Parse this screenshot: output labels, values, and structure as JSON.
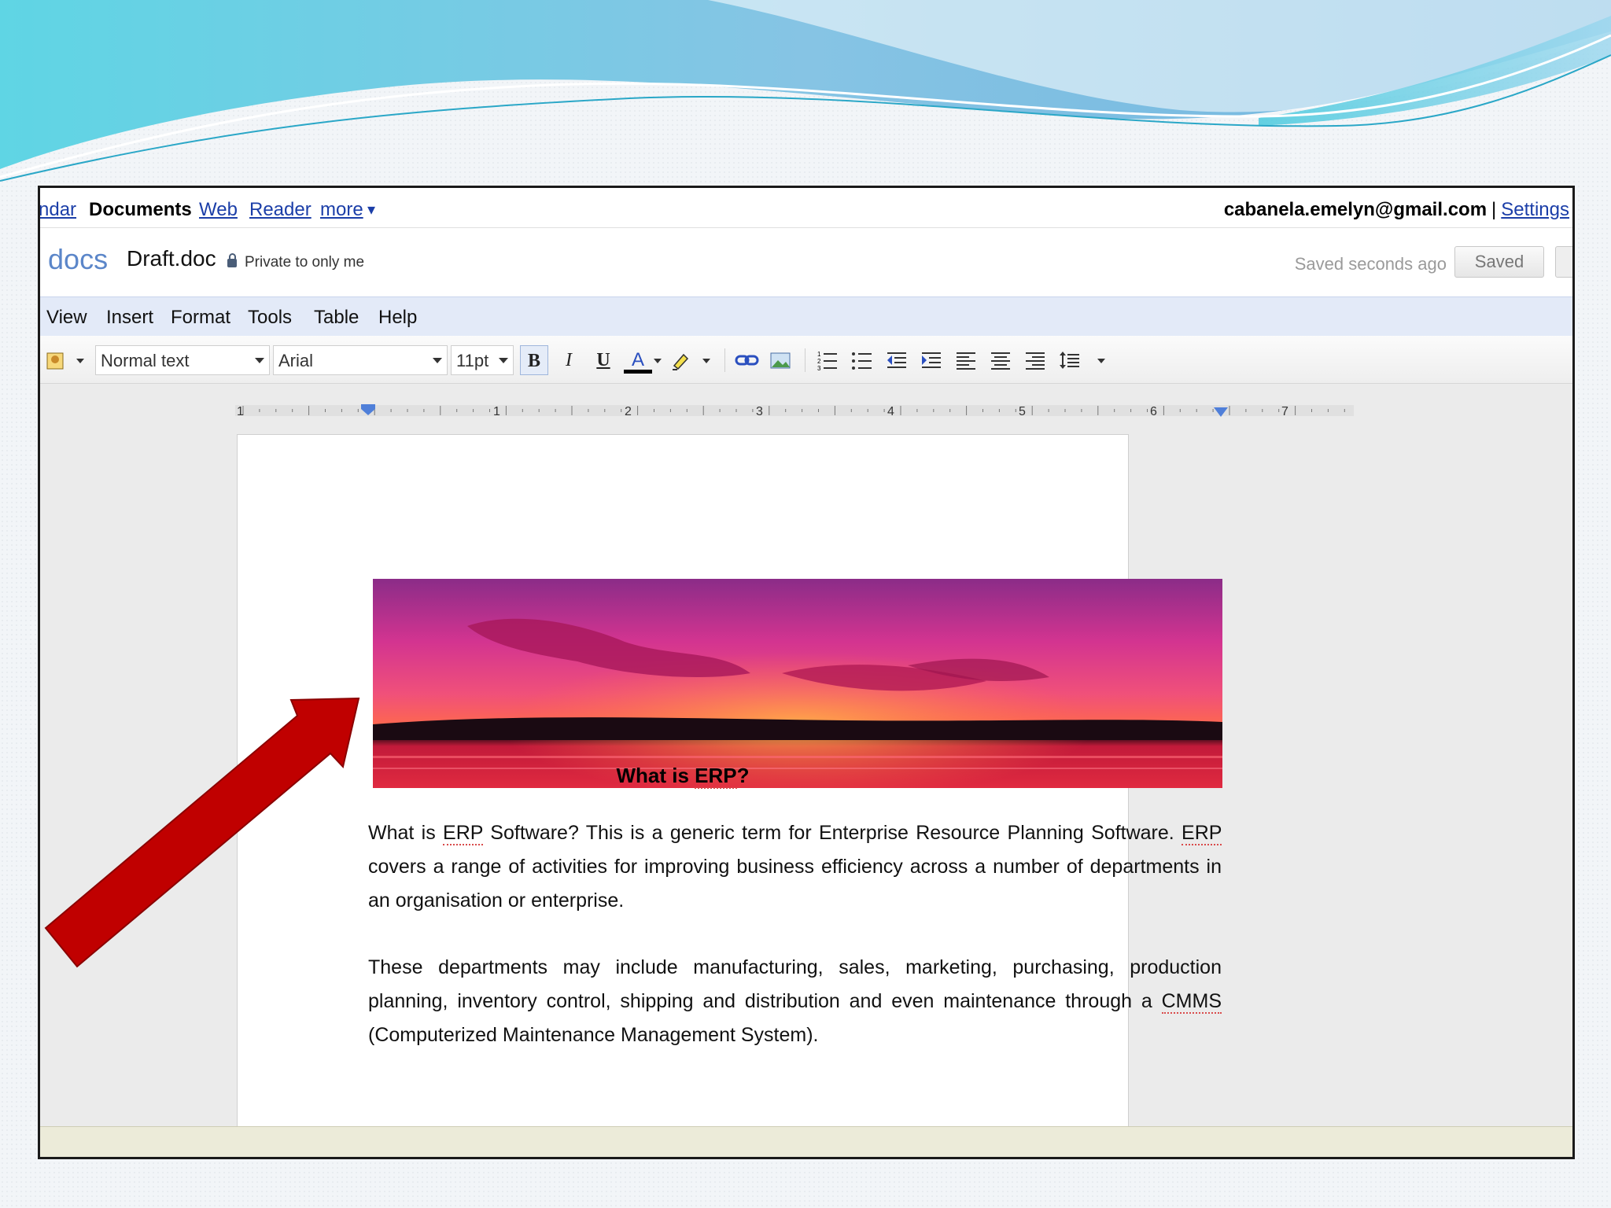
{
  "topnav": {
    "items": [
      {
        "label": "ndar",
        "style": "link"
      },
      {
        "label": "Documents",
        "style": "bold"
      },
      {
        "label": "Web",
        "style": "link"
      },
      {
        "label": "Reader",
        "style": "link"
      },
      {
        "label": "more",
        "style": "link"
      }
    ],
    "more_caret": "▾",
    "account_email": "cabanela.emelyn@gmail.com",
    "separator": "|",
    "settings_label": "Settings"
  },
  "docbar": {
    "logo": "docs",
    "logo_prefix": ":",
    "doc_title": "Draft.doc",
    "sharing": "Private to only me",
    "save_status": "Saved seconds ago",
    "saved_button": "Saved"
  },
  "menubar": {
    "items": [
      "View",
      "Insert",
      "Format",
      "Tools",
      "Table",
      "Help"
    ]
  },
  "toolbar": {
    "style_value": "Normal text",
    "font_value": "Arial",
    "size_value": "11pt",
    "bold": "B",
    "italic": "I",
    "underline": "U",
    "text_color": "A",
    "icons": [
      "style-icon",
      "bold-icon",
      "italic-icon",
      "underline-icon",
      "text-color-icon",
      "highlight-icon",
      "link-icon",
      "image-icon",
      "numbered-list-icon",
      "bulleted-list-icon",
      "decrease-indent-icon",
      "increase-indent-icon",
      "align-left-icon",
      "align-center-icon",
      "align-right-icon",
      "line-spacing-icon"
    ]
  },
  "ruler": {
    "labels": [
      "1",
      "1",
      "2",
      "3",
      "4",
      "5",
      "6",
      "7"
    ]
  },
  "document": {
    "heading_pre": "What is ",
    "heading_erp": "ERP",
    "heading_post": "?",
    "p1_a": "What is ",
    "p1_erp1": "ERP",
    "p1_b": " Software? This is a generic term for Enterprise Resource Planning Software. ",
    "p1_erp2": "ERP",
    "p1_c": " covers a range of activities for improving business efficiency across a number of departments in an organisation or enterprise.",
    "p2_a": "These departments may include manufacturing, sales, marketing, purchasing, production planning, inventory control, shipping and distribution and even maintenance through a ",
    "p2_cmms": "CMMS",
    "p2_b": " (Computerized Maintenance Management System)."
  },
  "colors": {
    "arrow": "#c00000",
    "link": "#1b3ea8",
    "menubar": "#e3eaf8",
    "banner_teal": "#5fd0e0",
    "banner_blue": "#7eb5e0"
  }
}
